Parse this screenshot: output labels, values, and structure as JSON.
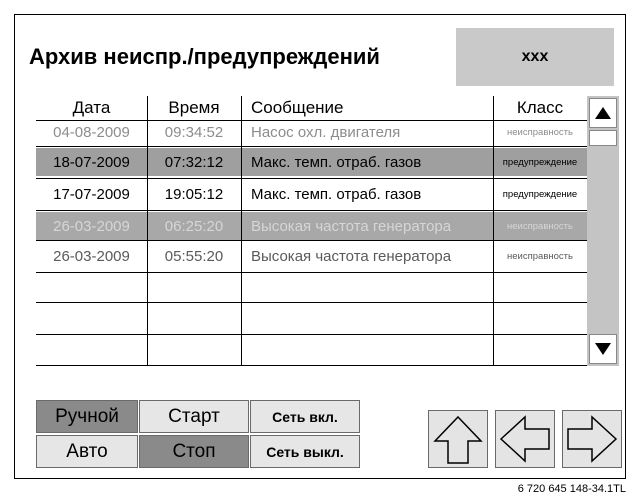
{
  "header": {
    "title": "Архив неиспр./предупреждений",
    "code": "xxx"
  },
  "table": {
    "columns": [
      "Дата",
      "Время",
      "Сообщение",
      "Класс"
    ],
    "rows": [
      {
        "date": "04-08-2009",
        "time": "09:34:52",
        "message": "Насос охл. двигателя",
        "class": "неисправность",
        "state": "light"
      },
      {
        "date": "18-07-2009",
        "time": "07:32:12",
        "message": "Макс. темп. отраб. газов",
        "class": "предупреждение",
        "state": "selected"
      },
      {
        "date": "17-07-2009",
        "time": "19:05:12",
        "message": "Макс. темп. отраб. газов",
        "class": "предупреждение",
        "state": "normal"
      },
      {
        "date": "26-03-2009",
        "time": "06:25:20",
        "message": "Высокая частота генератора",
        "class": "неисправность",
        "state": "grey"
      },
      {
        "date": "26-03-2009",
        "time": "05:55:20",
        "message": "Высокая частота генератора",
        "class": "неисправность",
        "state": "light"
      }
    ]
  },
  "scroll": {
    "up_icon": "triangle-up-icon",
    "down_icon": "triangle-down-icon"
  },
  "controls": {
    "manual": "Ручной",
    "start": "Старт",
    "mains_on": "Сеть вкл.",
    "auto": "Авто",
    "stop": "Стоп",
    "mains_off": "Сеть выкл."
  },
  "navigation": {
    "up_icon": "arrow-up-icon",
    "left_icon": "arrow-left-icon",
    "right_icon": "arrow-right-icon"
  },
  "footer": {
    "reference": "6 720 645 148-34.1TL"
  },
  "colors": {
    "selected_row": "#9f9f9f",
    "header_box": "#c9c9c9",
    "active_button": "#8a8a8a",
    "inactive_button": "#e6e6e6"
  }
}
